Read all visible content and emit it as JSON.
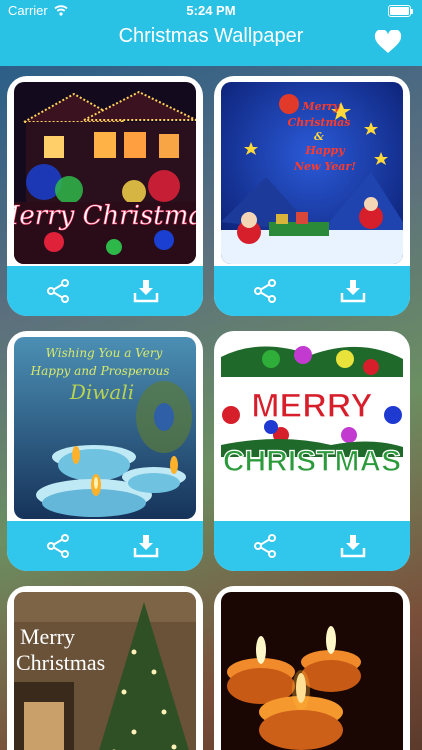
{
  "status_bar": {
    "carrier": "Carrier",
    "time": "5:24 PM",
    "wifi_icon": "wifi-icon",
    "battery_icon": "battery-icon"
  },
  "nav_bar": {
    "title": "Christmas Wallpaper",
    "favorites_icon": "heart-icon"
  },
  "colors": {
    "header": "#29c2e5",
    "action_bar": "#31c6eb",
    "card_background": "#ffffff"
  },
  "wallpapers": [
    {
      "image": "christmas-lights-house",
      "caption": "Merry Christmas",
      "actions": [
        "share-icon",
        "download-icon"
      ]
    },
    {
      "image": "merry-christmas-happy-new-year-santa",
      "caption_lines": [
        "Merry",
        "Christmas",
        "&",
        "Happy",
        "New Year!"
      ],
      "actions": [
        "share-icon",
        "download-icon"
      ]
    },
    {
      "image": "diwali-diyas",
      "caption_lines": [
        "Wishing You a Very",
        "Happy and Prosperous",
        "Diwali"
      ],
      "actions": [
        "share-icon",
        "download-icon"
      ]
    },
    {
      "image": "merry-christmas-ornaments",
      "caption_lines": [
        "MERRY",
        "CHRISTMAS"
      ],
      "actions": [
        "share-icon",
        "download-icon"
      ]
    },
    {
      "image": "christmas-tree-fireplace",
      "caption_lines": [
        "Merry",
        "Christmas"
      ],
      "actions": []
    },
    {
      "image": "candles",
      "actions": []
    }
  ]
}
